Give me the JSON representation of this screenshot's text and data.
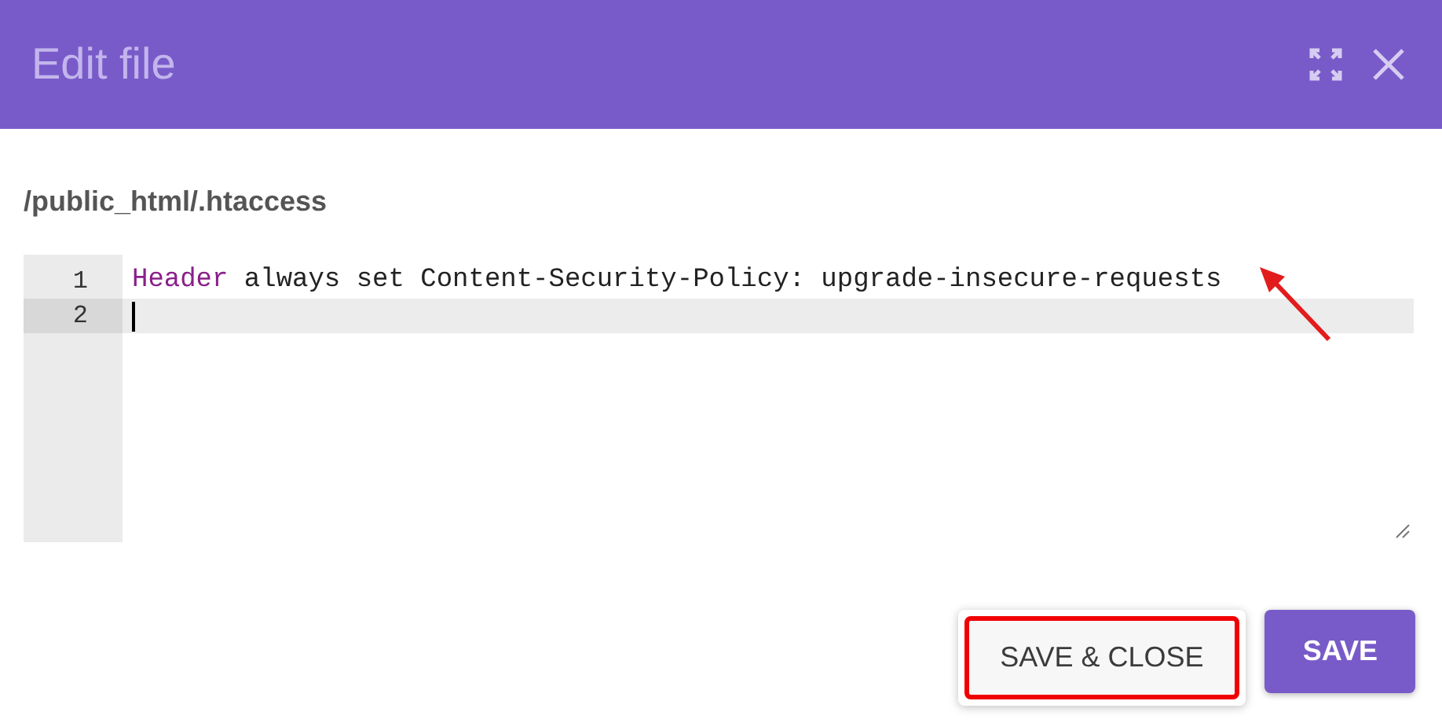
{
  "dialog": {
    "title": "Edit file"
  },
  "file_path": "/public_html/.htaccess",
  "editor": {
    "lines": [
      {
        "number": "1",
        "active": false,
        "tokens": [
          {
            "kind": "keyword",
            "text": "Header"
          },
          {
            "kind": "plain",
            "text": " always set Content-Security-Policy: upgrade-insecure-requests"
          }
        ]
      },
      {
        "number": "2",
        "active": true
      }
    ]
  },
  "buttons": [
    {
      "label": "SAVE & CLOSE",
      "kind": "secondary",
      "highlighted": true
    },
    {
      "label": "SAVE",
      "kind": "primary",
      "highlighted": false
    }
  ]
}
